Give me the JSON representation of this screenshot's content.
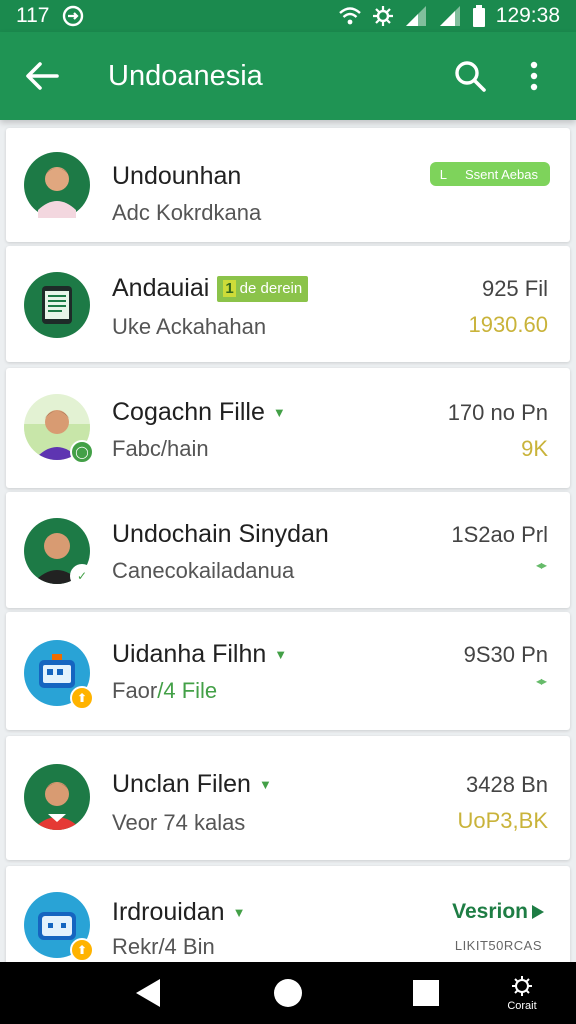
{
  "status_bar": {
    "left_text": "117",
    "time": "129:38"
  },
  "app_bar": {
    "title": "Undoanesia"
  },
  "items": [
    {
      "name": "Undounhan",
      "subtitle": "Adc Kokrdkana",
      "pill_icon": "L",
      "pill_label": "Ssent Aebas",
      "avatar_bg": "#1d7a46"
    },
    {
      "name": "Andauiai",
      "tag_prefix": "1",
      "tag_label": "de derein",
      "subtitle": "Uke Ackahahan",
      "right_top": "925 Fil",
      "right_bottom": "1930.60",
      "avatar_bg": "#1d7a46"
    },
    {
      "name": "Cogachn Fille",
      "subtitle": "Fabc/hain",
      "right_top": "170 no Pn",
      "right_bottom": "9K",
      "avatar_bg": "#e3f2d3"
    },
    {
      "name": "Undochain Sinydan",
      "subtitle": "Canecokailadanua",
      "right_top": "1S2ao Prl",
      "avatar_bg": "#1d7a46"
    },
    {
      "name": "Uidanha Filhn",
      "subtitle_main": "Faor",
      "subtitle_accent": "/4 File",
      "right_top": "9S30 Pn",
      "avatar_bg": "#29a3d6"
    },
    {
      "name": "Unclan Filen",
      "subtitle": "Veor 74 kalas",
      "right_top": "3428 Bn",
      "right_bottom": "UoP3,BK",
      "avatar_bg": "#1d7a46"
    },
    {
      "name": "Irdrouidan",
      "subtitle": "Rekr/4 Bin",
      "version_label": "Vesrion",
      "small_code": "LIKIT50RCAS"
    }
  ],
  "nav_bar": {
    "recent_label": "Corait"
  },
  "colors": {
    "status_bar": "#1b8a4e",
    "app_bar": "#1f9454",
    "accent_green": "#43a047",
    "amount_gold": "#c9b33a"
  }
}
